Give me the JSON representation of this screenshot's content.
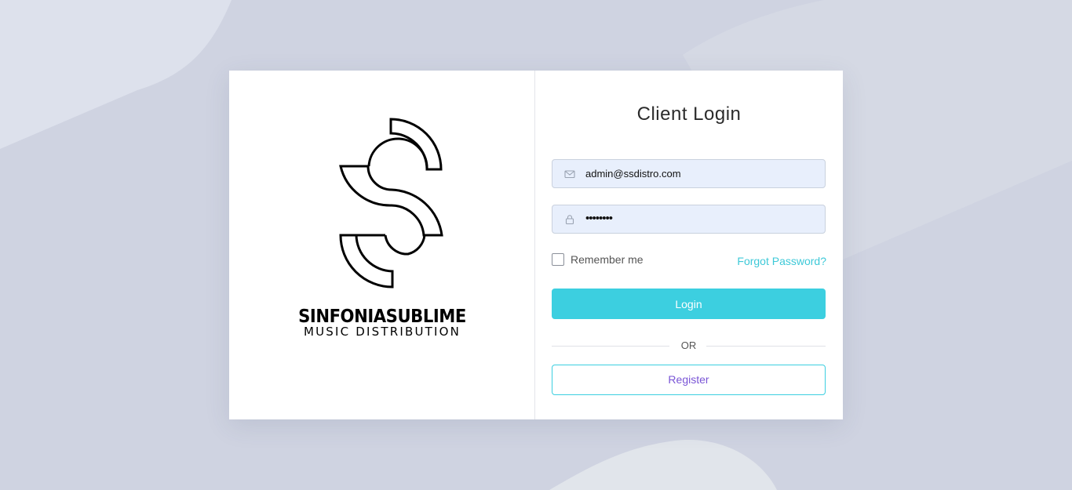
{
  "brand": {
    "name": "SINFONIASUBLIME",
    "tagline": "MUSIC DISTRIBUTION",
    "logo_icon": "s-arc-logo-icon"
  },
  "login": {
    "title": "Client Login",
    "email": {
      "icon": "envelope-icon",
      "value": "admin@ssdistro.com"
    },
    "password": {
      "icon": "lock-icon",
      "value": "••••••••"
    },
    "remember_label": "Remember me",
    "remember_checked": false,
    "forgot_label": "Forgot Password?",
    "login_label": "Login",
    "or_label": "OR",
    "register_label": "Register"
  },
  "colors": {
    "accent": "#3ccfe0",
    "register_text": "#7a55d6",
    "background": "#cfd3e1",
    "input_bg": "#e8effc"
  }
}
